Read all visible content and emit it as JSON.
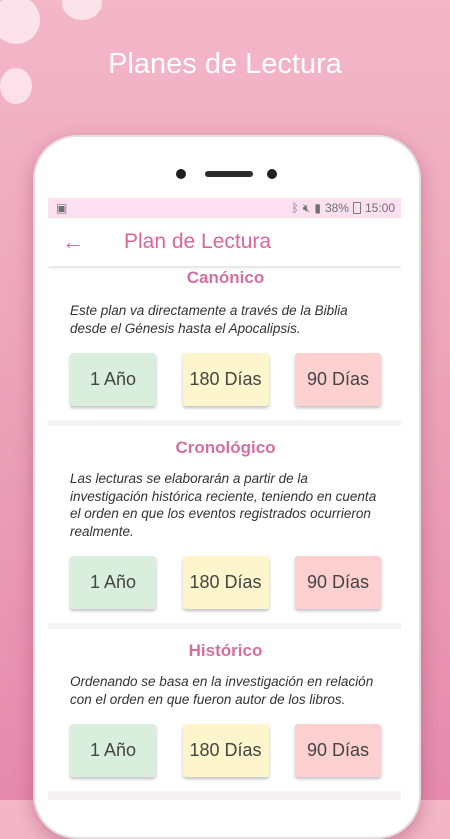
{
  "promo": {
    "title": "Planes de Lectura"
  },
  "statusbar": {
    "signal": "38%",
    "time": "15:00"
  },
  "appbar": {
    "back_icon": "arrow-left-icon",
    "title": "Plan de Lectura"
  },
  "plans": [
    {
      "title": "Canónico",
      "description": "Este plan va directamente a través de la Biblia desde el Génesis hasta el Apocalipsis.",
      "options": [
        "1 Año",
        "180 Días",
        "90 Días"
      ]
    },
    {
      "title": "Cronológico",
      "description": "Las lecturas se elaborarán a partir de la investigación histórica reciente, teniendo en cuenta el orden en que los eventos registrados ocurrieron realmente.",
      "options": [
        "1 Año",
        "180 Días",
        "90 Días"
      ]
    },
    {
      "title": "Histórico",
      "description": "Ordenando se basa en la investigación en relación con el orden en que fueron autor de los libros.",
      "options": [
        "1 Año",
        "180 Días",
        "90 Días"
      ]
    }
  ],
  "colors": {
    "accent": "#d9669b",
    "one_year": "#d9eedd",
    "half_year": "#fdf6cc",
    "ninety_days": "#ffd0d0"
  }
}
